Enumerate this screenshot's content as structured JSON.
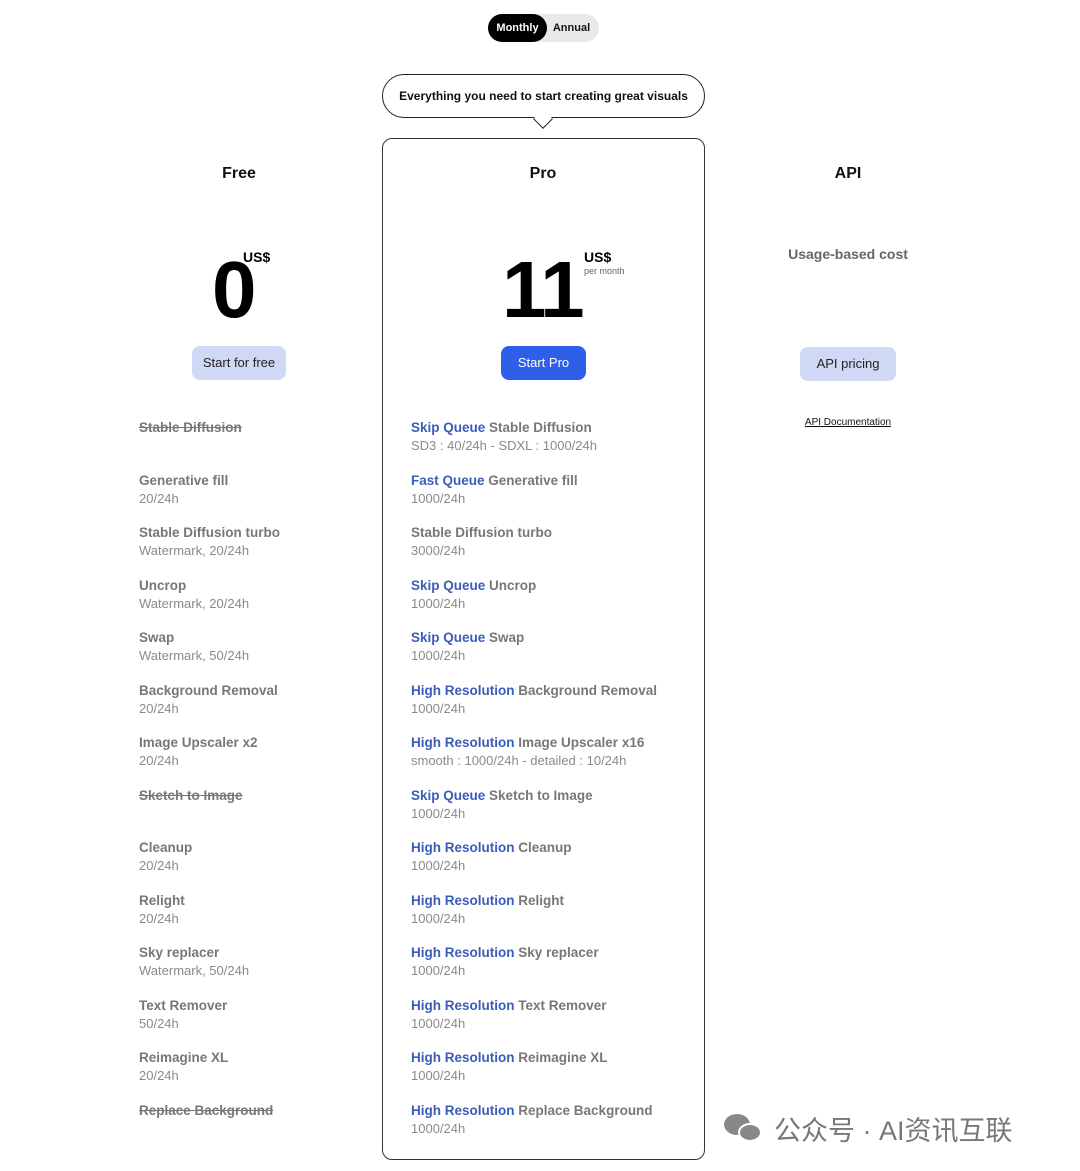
{
  "billing_toggle": {
    "monthly": "Monthly",
    "annual": "Annual"
  },
  "callout": "Everything you need to start creating great visuals",
  "plans": {
    "free": {
      "title": "Free",
      "price": "0",
      "currency": "US$",
      "cta": "Start for free"
    },
    "pro": {
      "title": "Pro",
      "price": "11",
      "currency": "US$",
      "period": "per month",
      "cta": "Start Pro"
    },
    "api": {
      "title": "API",
      "usage": "Usage-based cost",
      "cta": "API pricing",
      "docs_link": "API Documentation"
    }
  },
  "free_features": [
    {
      "name": "Stable Diffusion",
      "sub": "",
      "strike": true
    },
    {
      "name": "Generative fill",
      "sub": "20/24h"
    },
    {
      "name": "Stable Diffusion turbo",
      "sub": "Watermark, 20/24h"
    },
    {
      "name": "Uncrop",
      "sub": "Watermark, 20/24h"
    },
    {
      "name": "Swap",
      "sub": "Watermark, 50/24h"
    },
    {
      "name": "Background Removal",
      "sub": "20/24h"
    },
    {
      "name": "Image Upscaler x2",
      "sub": "20/24h"
    },
    {
      "name": "Sketch to Image",
      "sub": "",
      "strike": true
    },
    {
      "name": "Cleanup",
      "sub": "20/24h"
    },
    {
      "name": "Relight",
      "sub": "20/24h"
    },
    {
      "name": "Sky replacer",
      "sub": "Watermark, 50/24h"
    },
    {
      "name": "Text Remover",
      "sub": "50/24h"
    },
    {
      "name": "Reimagine XL",
      "sub": "20/24h"
    },
    {
      "name": "Replace Background",
      "sub": "",
      "strike": true
    }
  ],
  "pro_features": [
    {
      "tag": "Skip Queue",
      "name": "Stable Diffusion",
      "sub": "SD3 : 40/24h - SDXL : 1000/24h"
    },
    {
      "tag": "Fast Queue",
      "name": "Generative fill",
      "sub": "1000/24h"
    },
    {
      "tag": "",
      "name": "Stable Diffusion turbo",
      "sub": "3000/24h"
    },
    {
      "tag": "Skip Queue",
      "name": "Uncrop",
      "sub": "1000/24h"
    },
    {
      "tag": "Skip Queue",
      "name": "Swap",
      "sub": "1000/24h"
    },
    {
      "tag": "High Resolution",
      "name": "Background Removal",
      "sub": "1000/24h"
    },
    {
      "tag": "High Resolution",
      "name": "Image Upscaler x16",
      "sub": "smooth : 1000/24h - detailed : 10/24h"
    },
    {
      "tag": "Skip Queue",
      "name": "Sketch to Image",
      "sub": "1000/24h"
    },
    {
      "tag": "High Resolution",
      "name": "Cleanup",
      "sub": "1000/24h"
    },
    {
      "tag": "High Resolution",
      "name": "Relight",
      "sub": "1000/24h"
    },
    {
      "tag": "High Resolution",
      "name": "Sky replacer",
      "sub": "1000/24h"
    },
    {
      "tag": "High Resolution",
      "name": "Text Remover",
      "sub": "1000/24h"
    },
    {
      "tag": "High Resolution",
      "name": "Reimagine XL",
      "sub": "1000/24h"
    },
    {
      "tag": "High Resolution",
      "name": "Replace Background",
      "sub": "1000/24h"
    }
  ],
  "watermark": "公众号 · AI资讯互联",
  "colors": {
    "accent": "#2f5ee8",
    "highlight_text": "#3b5cb8",
    "soft_button": "#cfd8f4"
  }
}
